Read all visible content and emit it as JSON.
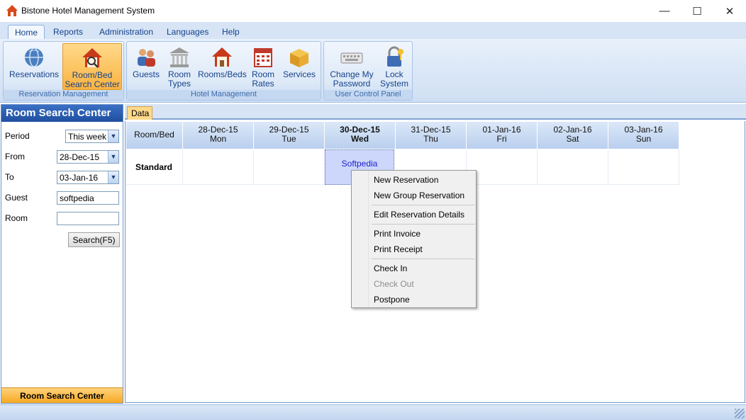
{
  "window": {
    "title": "Bistone Hotel Management System",
    "minimize": "—",
    "maximize": "☐",
    "close": "✕"
  },
  "menu_tabs": [
    "Home",
    "Reports",
    "Administration",
    "Languages",
    "Help"
  ],
  "ribbon": {
    "groups": [
      {
        "label": "Reservation Management",
        "buttons": [
          {
            "line1": "Reservations",
            "line2": "",
            "icon": "globe-icon"
          },
          {
            "line1": "Room/Bed",
            "line2": "Search Center",
            "icon": "house-search-icon",
            "active": true
          }
        ]
      },
      {
        "label": "Hotel Management",
        "buttons": [
          {
            "line1": "Guests",
            "line2": "",
            "icon": "people-icon"
          },
          {
            "line1": "Room",
            "line2": "Types",
            "icon": "building-icon"
          },
          {
            "line1": "Rooms/Beds",
            "line2": "",
            "icon": "house-icon"
          },
          {
            "line1": "Room",
            "line2": "Rates",
            "icon": "calendar-icon"
          },
          {
            "line1": "Services",
            "line2": "",
            "icon": "box-icon"
          }
        ]
      },
      {
        "label": "User Control Panel",
        "buttons": [
          {
            "line1": "Change My",
            "line2": "Password",
            "icon": "keyboard-icon"
          },
          {
            "line1": "Lock",
            "line2": "System",
            "icon": "lock-icon"
          }
        ]
      }
    ]
  },
  "sidebar": {
    "title": "Room Search Center",
    "period_label": "Period",
    "period_value": "This week",
    "from_label": "From",
    "from_value": "28-Dec-15",
    "to_label": "To",
    "to_value": "03-Jan-16",
    "guest_label": "Guest",
    "guest_value": "softpedia",
    "room_label": "Room",
    "room_value": "",
    "search_button": "Search(F5)",
    "footer": "Room Search Center"
  },
  "data_tab": "Data",
  "grid": {
    "corner": "Room/Bed",
    "columns": [
      {
        "date": "28-Dec-15",
        "day": "Mon"
      },
      {
        "date": "29-Dec-15",
        "day": "Tue"
      },
      {
        "date": "30-Dec-15",
        "day": "Wed",
        "today": true
      },
      {
        "date": "31-Dec-15",
        "day": "Thu"
      },
      {
        "date": "01-Jan-16",
        "day": "Fri"
      },
      {
        "date": "02-Jan-16",
        "day": "Sat"
      },
      {
        "date": "03-Jan-16",
        "day": "Sun"
      }
    ],
    "row_label": "Standard",
    "reservation": "Softpedia"
  },
  "context_menu": [
    "New Reservation",
    "New Group Reservation",
    "Edit Reservation Details",
    "Print Invoice",
    "Print Receipt",
    "Check In",
    "Check Out",
    "Postpone"
  ],
  "colors": {
    "ribbon_active": "#f9b340",
    "sidebar_header": "#1f4f9f",
    "reservation_bg": "#cdd7fb"
  }
}
